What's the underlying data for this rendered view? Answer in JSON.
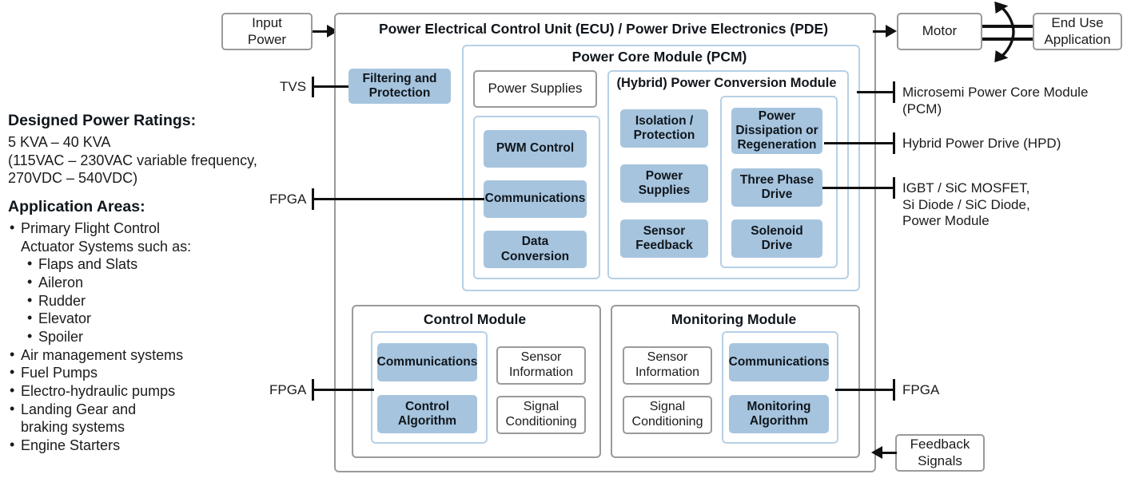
{
  "info_panel": {
    "ratings_heading": "Designed Power Ratings:",
    "ratings_line1": "5 KVA – 40 KVA",
    "ratings_line2": "(115VAC – 230VAC variable frequency,",
    "ratings_line3": "270VDC – 540VDC)",
    "applications_heading": "Application Areas:",
    "applications": [
      "Primary Flight Control",
      "Actuator Systems such as:",
      "Air management systems",
      "Fuel Pumps",
      "Electro-hydraulic pumps",
      "Landing Gear and",
      "braking systems",
      "Engine Starters"
    ],
    "flight_control_sub": [
      "Flaps and Slats",
      "Aileron",
      "Rudder",
      "Elevator",
      "Spoiler"
    ]
  },
  "external": {
    "input_power": "Input\nPower",
    "motor": "Motor",
    "end_use": "End Use\nApplication",
    "feedback_signals": "Feedback\nSignals",
    "tvs": "TVS",
    "fpga_power": "FPGA",
    "fpga_control": "FPGA",
    "fpga_monitoring": "FPGA",
    "callout_pcm": "Microsemi Power Core Module (PCM)",
    "callout_hpd": "Hybrid Power Drive (HPD)",
    "callout_devices": "IGBT / SiC MOSFET,\nSi Diode / SiC Diode,\nPower Module"
  },
  "ecu": {
    "title": "Power Electrical Control Unit (ECU) / Power Drive Electronics (PDE)",
    "filtering": "Filtering and\nProtection",
    "pcm": {
      "title": "Power Core Module (PCM)",
      "power_supplies": "Power Supplies",
      "control_blocks": [
        "PWM Control",
        "Communications",
        "Data\nConversion"
      ],
      "hpcm": {
        "title": "(Hybrid) Power Conversion Module",
        "left_blocks": [
          "Isolation /\nProtection",
          "Power\nSupplies",
          "Sensor\nFeedback"
        ],
        "right_blocks": [
          "Power\nDissipation or\nRegeneration",
          "Three Phase\nDrive",
          "Solenoid\nDrive"
        ]
      }
    },
    "control_module": {
      "title": "Control Module",
      "blue_blocks": [
        "Communications",
        "Control\nAlgorithm"
      ],
      "white_blocks": [
        "Sensor\nInformation",
        "Signal\nConditioning"
      ]
    },
    "monitoring_module": {
      "title": "Monitoring Module",
      "white_blocks": [
        "Sensor\nInformation",
        "Signal\nConditioning"
      ],
      "blue_blocks": [
        "Communications",
        "Monitoring\nAlgorithm"
      ]
    }
  },
  "colors": {
    "block_fill": "#a6c4de",
    "blue_border": "#b6d0e6",
    "gray_border": "#9a9a9c",
    "line": "#111111"
  }
}
